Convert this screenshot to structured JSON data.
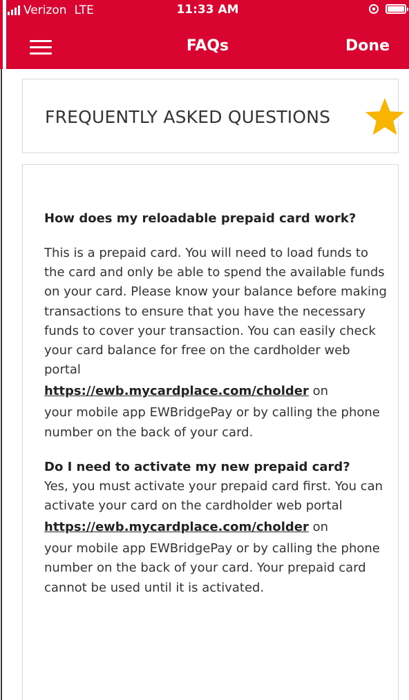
{
  "status_bar": {
    "carrier": "Verizon",
    "network": "LTE",
    "time": "11:33 AM"
  },
  "nav": {
    "title": "FAQs",
    "done_label": "Done",
    "menu_icon": "hamburger-menu-icon"
  },
  "title_card": {
    "heading": "FREQUENTLY ASKED QUESTIONS",
    "star_color": "#f7b500"
  },
  "faqs": [
    {
      "question": "How does my reloadable prepaid card work?",
      "answer_before_link": "This is a prepaid card. You will need to load funds to the card and only be able to spend the available funds on your card. Please know your balance before making transactions to ensure that you have the necessary funds to cover your transaction. You can easily check your card balance for free on the cardholder web portal",
      "link": "https://ewb.mycardplace.com/cholder",
      "answer_after_link_1": " on",
      "answer_after_link_2": "your mobile app EWBridgePay or by calling the phone number on the back of your card."
    },
    {
      "question": "Do I need to activate my new prepaid card?",
      "answer_before_link": "Yes, you must activate your prepaid card first. You can activate your card on the cardholder web portal",
      "link": "https://ewb.mycardplace.com/cholder",
      "answer_after_link_1": " on",
      "answer_after_link_2": "your mobile app EWBridgePay or by calling the phone number on the back of your card.  Your prepaid card cannot be used until it is activated."
    }
  ],
  "colors": {
    "brand_red": "#d9042f",
    "text": "#333333",
    "border": "#d9d9d9"
  }
}
